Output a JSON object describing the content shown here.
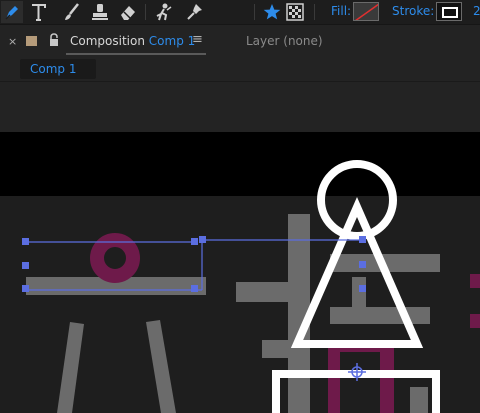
{
  "toolbar": {
    "tools": [
      {
        "name": "pen-tool",
        "active": true
      },
      {
        "name": "type-tool",
        "active": false
      },
      {
        "name": "brush-tool",
        "active": false
      },
      {
        "name": "clone-stamp-tool",
        "active": false
      },
      {
        "name": "eraser-tool",
        "active": false
      },
      {
        "name": "roto-brush-tool",
        "active": false
      },
      {
        "name": "puppet-pin-tool",
        "active": false
      }
    ],
    "fill_label": "Fill:",
    "stroke_label": "Stroke:",
    "stroke_width": "2",
    "fill_swatch_state": "none",
    "stroke_color": "#ffffff"
  },
  "panel": {
    "close_glyph": "×",
    "composition_label": "Composition",
    "comp_name": "Comp 1",
    "menu_glyph": "≡",
    "layer_tab": "Layer  (none)"
  },
  "navigator": {
    "comp_chip": "Comp 1"
  },
  "colors": {
    "accent": "#2d8ceb",
    "canvas": "#1e1e1e",
    "letterbox": "#000000",
    "selection": "#5b6ee1",
    "shape_gray": "#6b6b6b",
    "magenta": "#6e1a4a",
    "stroke_white": "#ffffff"
  }
}
